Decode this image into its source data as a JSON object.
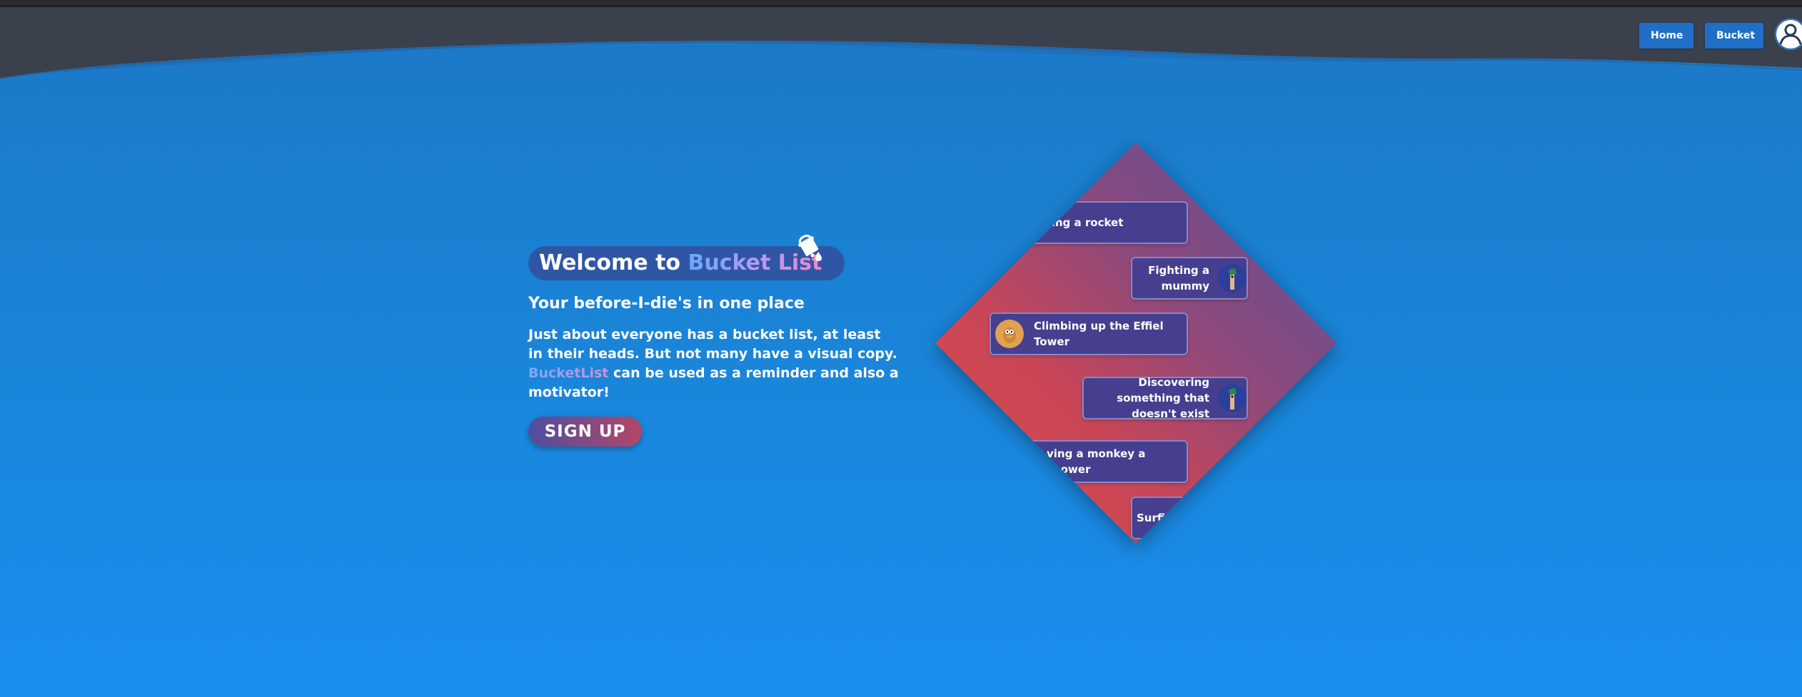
{
  "nav": {
    "home_label": "Home",
    "bucket_label": "Bucket"
  },
  "hero": {
    "welcome_prefix": "Welcome to ",
    "welcome_brand": "Bucket List",
    "subtitle": "Your before-I-die's in one place",
    "desc_before": "Just about everyone has a bucket list, at least in their heads. But not many have a visual copy. ",
    "desc_brand": "BucketList",
    "desc_after": " can be used as a reminder and also a motivator!",
    "signup_label": "SIGN UP"
  },
  "cards": [
    {
      "text": "Building a rocket",
      "visible_text": "ding a rocket"
    },
    {
      "text": "Fighting a mummy",
      "avatar": "ferb-avatar"
    },
    {
      "text": "Climbing up the Effiel Tower",
      "avatar": "perry-avatar"
    },
    {
      "text": "Discovering something that doesn't exist",
      "avatar": "ferb-avatar"
    },
    {
      "text": "Giving a monkey a shower",
      "visible_text": "ving a monkey a shower"
    },
    {
      "text": "Surfing",
      "visible_text": "Surfi"
    }
  ],
  "colors": {
    "header": "#3a404c",
    "page_blue": "#1a87dc",
    "nav_button": "#1f6fc6",
    "card_bg": "#463f8f",
    "card_border": "#8a86c6",
    "diamond_red": "#e24b45",
    "diamond_purple": "#5b4f9a"
  }
}
